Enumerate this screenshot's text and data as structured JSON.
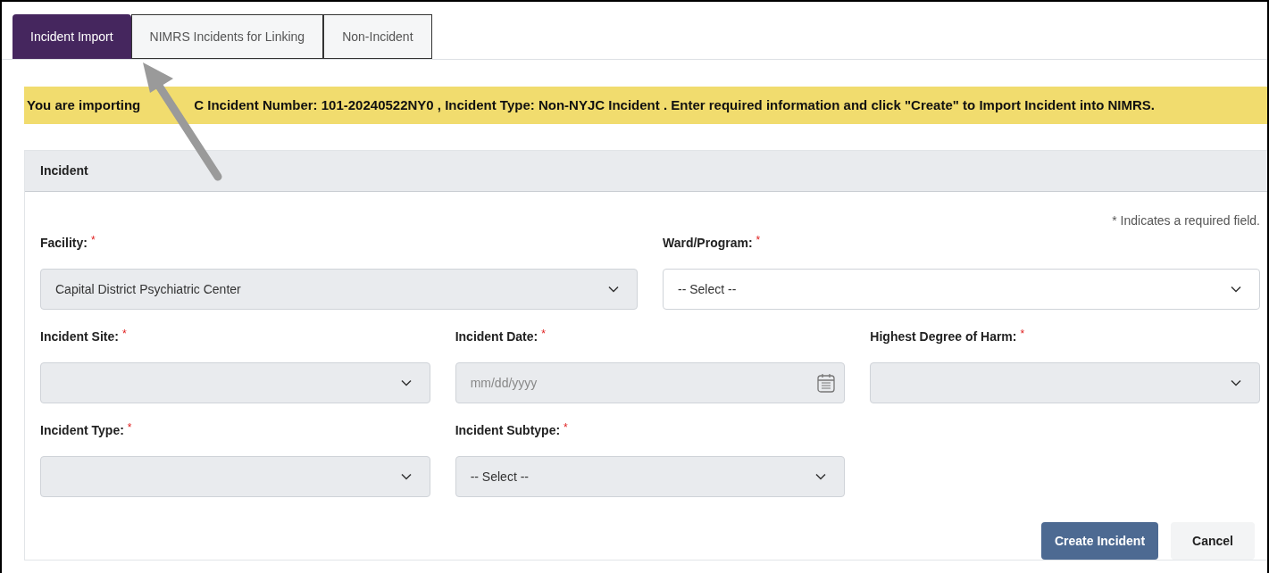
{
  "tabs": [
    {
      "label": "Incident Import",
      "selected": true
    },
    {
      "label": "NIMRS Incidents for Linking",
      "selected": false
    },
    {
      "label": "Non-Incident",
      "selected": false
    }
  ],
  "banner": {
    "before_arrow": "You are importing",
    "after_arrow": "C Incident Number: 101-20240522NY0 , Incident Type: Non-NYJC Incident . Enter required information and click \"Create\" to Import Incident into NIMRS."
  },
  "panel": {
    "title": "Incident",
    "required_note": "* Indicates a required field.",
    "top_row": [
      {
        "label": "Facility:",
        "required_mark": "*",
        "kind": "select",
        "value": "Capital District Psychiatric Center",
        "disabled": true
      },
      {
        "label": "Ward/Program:",
        "required_mark": "*",
        "kind": "select",
        "value": "-- Select --",
        "disabled": false
      }
    ],
    "fields": [
      {
        "label": "Incident Site:",
        "required_mark": "*",
        "kind": "select",
        "disabled": true
      },
      {
        "label": "Incident Date:",
        "required_mark": "*",
        "kind": "date",
        "placeholder": "mm/dd/yyyy",
        "disabled": true
      },
      {
        "label": "Highest Degree of Harm:",
        "required_mark": "*",
        "kind": "select",
        "disabled": true
      },
      {
        "label": "Incident Type:",
        "required_mark": "*",
        "kind": "select",
        "disabled": true
      },
      {
        "label": "Incident Subtype:",
        "required_mark": "*",
        "kind": "select",
        "value": "-- Select --",
        "disabled": true
      }
    ],
    "buttons": [
      {
        "label": "Create Incident",
        "kind": "primary"
      },
      {
        "label": "Cancel",
        "kind": "secondary"
      }
    ]
  }
}
